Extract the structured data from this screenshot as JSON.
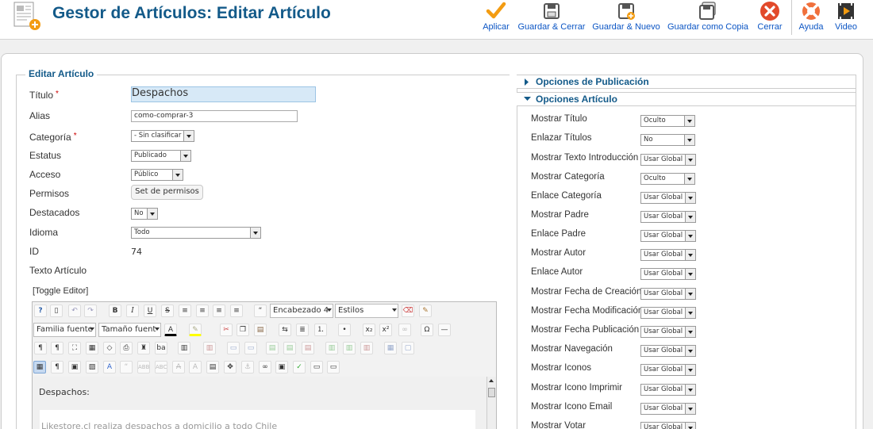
{
  "header": {
    "title": "Gestor de Artículos: Editar Artículo",
    "toolbar": {
      "apply": "Aplicar",
      "save_close": "Guardar & Cerrar",
      "save_new": "Guardar & Nuevo",
      "save_copy": "Guardar como Copia",
      "close": "Cerrar",
      "help": "Ayuda",
      "video": "Video"
    }
  },
  "form": {
    "legend": "Editar Artículo",
    "title_label": "Título",
    "title_value": "Despachos",
    "alias_label": "Alias",
    "alias_value": "como-comprar-3",
    "category_label": "Categoría",
    "category_value": "- Sin clasificar",
    "status_label": "Estatus",
    "status_value": "Publicado",
    "access_label": "Acceso",
    "access_value": "Público",
    "permissions_label": "Permisos",
    "permissions_button": "Set de permisos",
    "featured_label": "Destacados",
    "featured_value": "No",
    "language_label": "Idioma",
    "language_value": "Todo",
    "id_label": "ID",
    "id_value": "74",
    "text_label": "Texto Artículo",
    "required_mark": "*"
  },
  "editor": {
    "toggle": "[Toggle Editor]",
    "format_select": "Encabezado 4",
    "styles_select": "Estilos",
    "font_family_select": "Familia fuente",
    "font_size_select": "Tamaño fuent",
    "content_heading": "Despachos:",
    "content_text": "Likestore.cl realiza despachos a domicilio a todo Chile"
  },
  "sidebar": {
    "publishing_title": "Opciones de Publicación",
    "article_options_title": "Opciones Artículo",
    "options": [
      {
        "label": "Mostrar Título",
        "value": "Oculto"
      },
      {
        "label": "Enlazar Títulos",
        "value": "No"
      },
      {
        "label": "Mostrar Texto Introducción",
        "value": "Usar Global"
      },
      {
        "label": "Mostrar Categoría",
        "value": "Oculto"
      },
      {
        "label": "Enlace Categoría",
        "value": "Usar Global"
      },
      {
        "label": "Mostrar Padre",
        "value": "Usar Global"
      },
      {
        "label": "Enlace Padre",
        "value": "Usar Global"
      },
      {
        "label": "Mostrar Autor",
        "value": "Usar Global"
      },
      {
        "label": "Enlace Autor",
        "value": "Usar Global"
      },
      {
        "label": "Mostrar Fecha de Creación",
        "value": "Usar Global"
      },
      {
        "label": "Mostrar Fecha Modificación",
        "value": "Usar Global"
      },
      {
        "label": "Mostrar Fecha Publicación",
        "value": "Usar Global"
      },
      {
        "label": "Mostrar Navegación",
        "value": "Usar Global"
      },
      {
        "label": "Mostrar Iconos",
        "value": "Usar Global"
      },
      {
        "label": "Mostrar Icono Imprimir",
        "value": "Usar Global"
      },
      {
        "label": "Mostrar Icono Email",
        "value": "Usar Global"
      },
      {
        "label": "Mostrar Votar",
        "value": "Usar Global"
      }
    ]
  }
}
